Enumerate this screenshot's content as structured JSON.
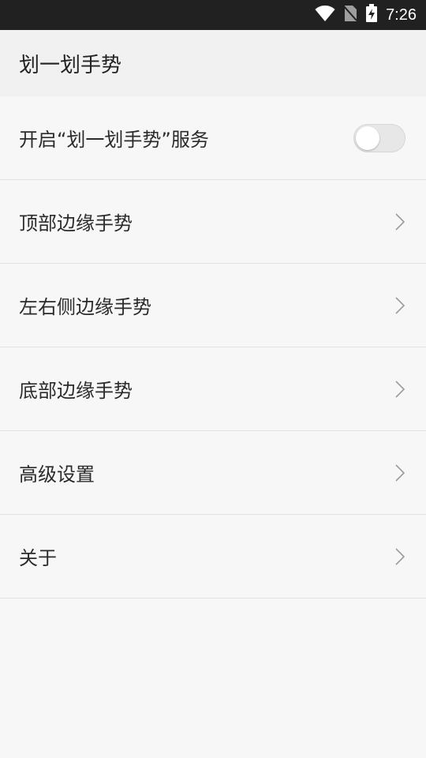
{
  "status_bar": {
    "time": "7:26",
    "icons": [
      "wifi-icon",
      "no-sim-icon",
      "battery-charging-icon"
    ]
  },
  "app_bar": {
    "title": "划一划手势"
  },
  "settings": {
    "items": [
      {
        "label": "开启“划一划手势”服务",
        "type": "toggle",
        "enabled": false
      },
      {
        "label": "顶部边缘手势",
        "type": "chevron",
        "icon": "chevron-right-icon"
      },
      {
        "label": "左右侧边缘手势",
        "type": "chevron",
        "icon": "chevron-right-icon"
      },
      {
        "label": "底部边缘手势",
        "type": "chevron",
        "icon": "chevron-right-icon"
      },
      {
        "label": "高级设置",
        "type": "chevron",
        "icon": "chevron-right-icon"
      },
      {
        "label": "关于",
        "type": "chevron",
        "icon": "chevron-right-icon"
      }
    ]
  },
  "colors": {
    "status_bar_bg": "#212121",
    "page_bg": "#f7f7f7",
    "divider": "#e2e2e2"
  }
}
